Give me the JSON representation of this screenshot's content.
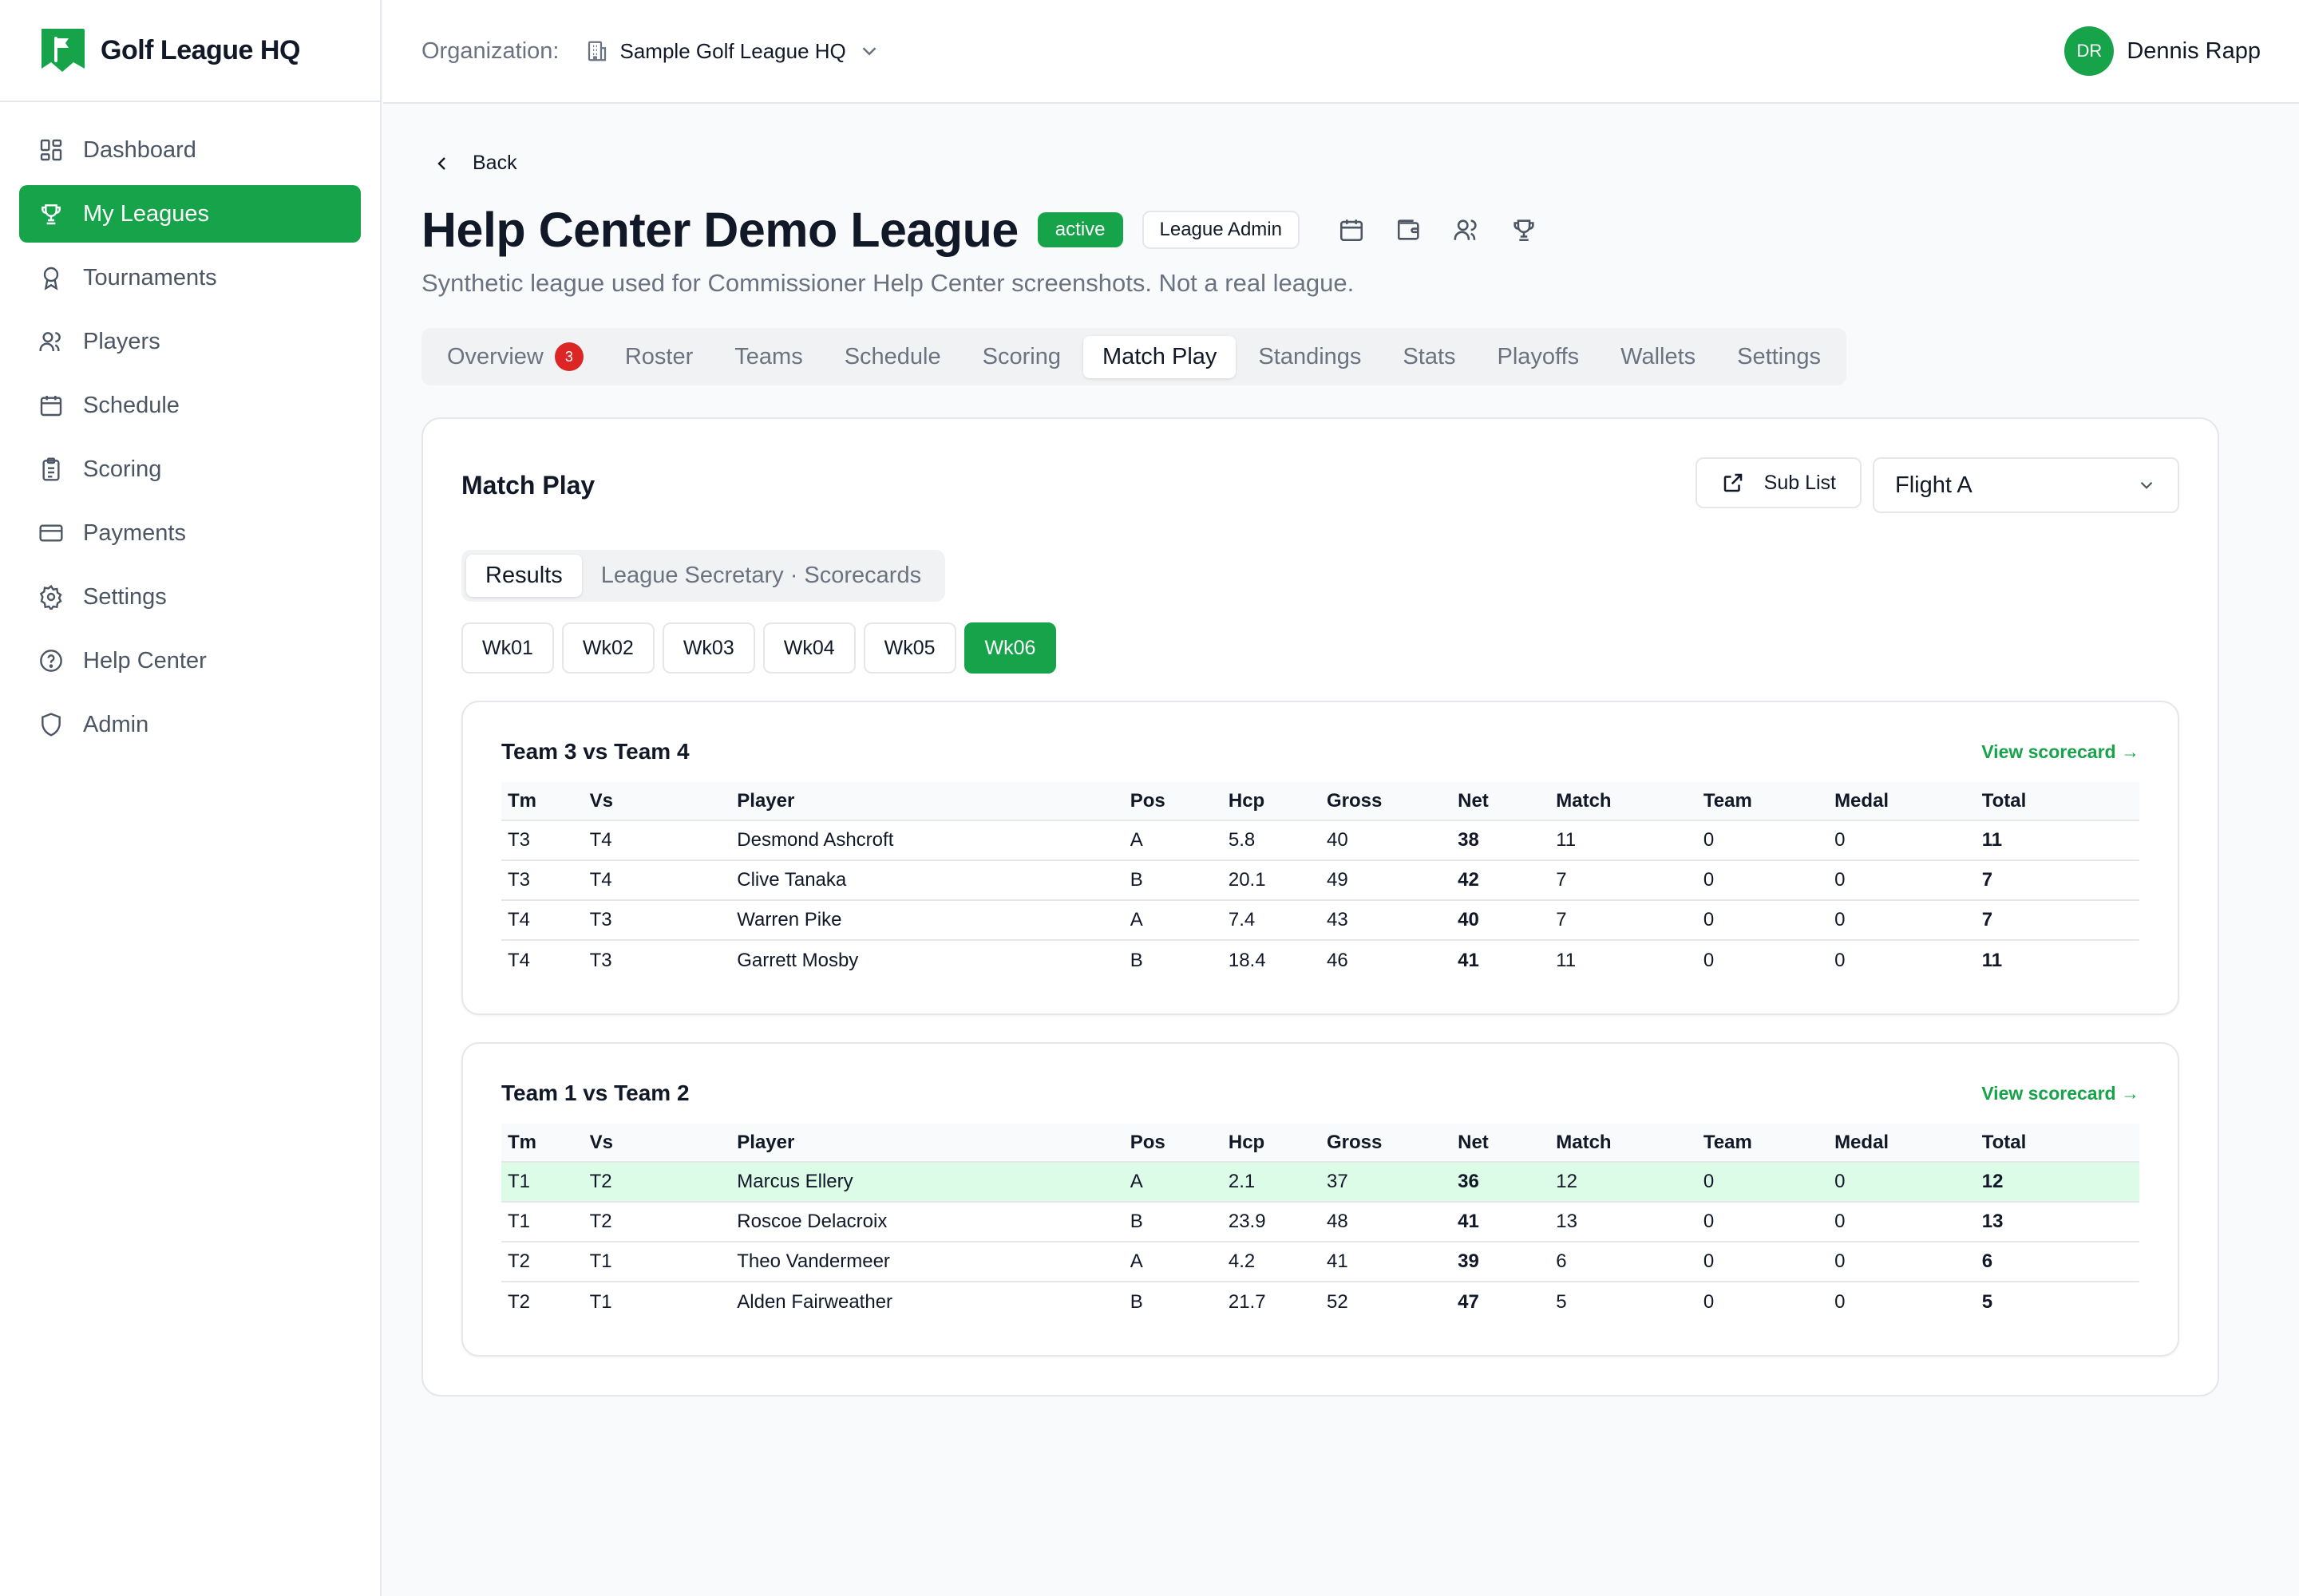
{
  "brand": {
    "name": "Golf League HQ",
    "color": "#16a34a"
  },
  "sidebar": {
    "items": [
      {
        "label": "Dashboard",
        "icon": "dashboard-icon",
        "active": false
      },
      {
        "label": "My Leagues",
        "icon": "trophy-icon",
        "active": true
      },
      {
        "label": "Tournaments",
        "icon": "award-icon",
        "active": false
      },
      {
        "label": "Players",
        "icon": "users-icon",
        "active": false
      },
      {
        "label": "Schedule",
        "icon": "calendar-icon",
        "active": false
      },
      {
        "label": "Scoring",
        "icon": "clipboard-icon",
        "active": false
      },
      {
        "label": "Payments",
        "icon": "credit-card-icon",
        "active": false
      },
      {
        "label": "Settings",
        "icon": "gear-icon",
        "active": false
      },
      {
        "label": "Help Center",
        "icon": "help-icon",
        "active": false
      },
      {
        "label": "Admin",
        "icon": "shield-icon",
        "active": false
      }
    ]
  },
  "header": {
    "org_label": "Organization:",
    "org_name": "Sample Golf League HQ",
    "user_initials": "DR",
    "user_name": "Dennis Rapp"
  },
  "page": {
    "back_label": "Back",
    "title": "Help Center Demo League",
    "status_badge": "active",
    "role_badge": "League Admin",
    "subtitle": "Synthetic league used for Commissioner Help Center screenshots. Not a real league.",
    "tabs": [
      {
        "label": "Overview",
        "count": "3",
        "active": false
      },
      {
        "label": "Roster",
        "active": false
      },
      {
        "label": "Teams",
        "active": false
      },
      {
        "label": "Schedule",
        "active": false
      },
      {
        "label": "Scoring",
        "active": false
      },
      {
        "label": "Match Play",
        "active": true
      },
      {
        "label": "Standings",
        "active": false
      },
      {
        "label": "Stats",
        "active": false
      },
      {
        "label": "Playoffs",
        "active": false
      },
      {
        "label": "Wallets",
        "active": false
      },
      {
        "label": "Settings",
        "active": false
      }
    ]
  },
  "matchplay": {
    "title": "Match Play",
    "sub_list_label": "Sub List",
    "flight_value": "Flight A",
    "subtabs": [
      {
        "label": "Results",
        "active": true
      },
      {
        "label": "League Secretary · Scorecards",
        "active": false
      }
    ],
    "weeks": [
      {
        "label": "Wk01",
        "active": false
      },
      {
        "label": "Wk02",
        "active": false
      },
      {
        "label": "Wk03",
        "active": false
      },
      {
        "label": "Wk04",
        "active": false
      },
      {
        "label": "Wk05",
        "active": false
      },
      {
        "label": "Wk06",
        "active": true
      }
    ],
    "columns": [
      "Tm",
      "Vs",
      "Player",
      "Pos",
      "Hcp",
      "Gross",
      "Net",
      "Match",
      "Team",
      "Medal",
      "Total"
    ],
    "scorecard_link": "View scorecard →",
    "matches": [
      {
        "title": "Team 3 vs Team 4",
        "rows": [
          {
            "tm": "T3",
            "vs": "T4",
            "player": "Desmond Ashcroft",
            "pos": "A",
            "hcp": "5.8",
            "gross": "40",
            "net": "38",
            "match": "11",
            "team": "0",
            "medal": "0",
            "total": "11",
            "highlight": false
          },
          {
            "tm": "T3",
            "vs": "T4",
            "player": "Clive Tanaka",
            "pos": "B",
            "hcp": "20.1",
            "gross": "49",
            "net": "42",
            "match": "7",
            "team": "0",
            "medal": "0",
            "total": "7",
            "highlight": false
          },
          {
            "tm": "T4",
            "vs": "T3",
            "player": "Warren Pike",
            "pos": "A",
            "hcp": "7.4",
            "gross": "43",
            "net": "40",
            "match": "7",
            "team": "0",
            "medal": "0",
            "total": "7",
            "highlight": false
          },
          {
            "tm": "T4",
            "vs": "T3",
            "player": "Garrett Mosby",
            "pos": "B",
            "hcp": "18.4",
            "gross": "46",
            "net": "41",
            "match": "11",
            "team": "0",
            "medal": "0",
            "total": "11",
            "highlight": false
          }
        ]
      },
      {
        "title": "Team 1 vs Team 2",
        "rows": [
          {
            "tm": "T1",
            "vs": "T2",
            "player": "Marcus Ellery",
            "pos": "A",
            "hcp": "2.1",
            "gross": "37",
            "net": "36",
            "match": "12",
            "team": "0",
            "medal": "0",
            "total": "12",
            "highlight": true
          },
          {
            "tm": "T1",
            "vs": "T2",
            "player": "Roscoe Delacroix",
            "pos": "B",
            "hcp": "23.9",
            "gross": "48",
            "net": "41",
            "match": "13",
            "team": "0",
            "medal": "0",
            "total": "13",
            "highlight": false
          },
          {
            "tm": "T2",
            "vs": "T1",
            "player": "Theo Vandermeer",
            "pos": "A",
            "hcp": "4.2",
            "gross": "41",
            "net": "39",
            "match": "6",
            "team": "0",
            "medal": "0",
            "total": "6",
            "highlight": false
          },
          {
            "tm": "T2",
            "vs": "T1",
            "player": "Alden Fairweather",
            "pos": "B",
            "hcp": "21.7",
            "gross": "52",
            "net": "47",
            "match": "5",
            "team": "0",
            "medal": "0",
            "total": "5",
            "highlight": false
          }
        ]
      }
    ]
  }
}
